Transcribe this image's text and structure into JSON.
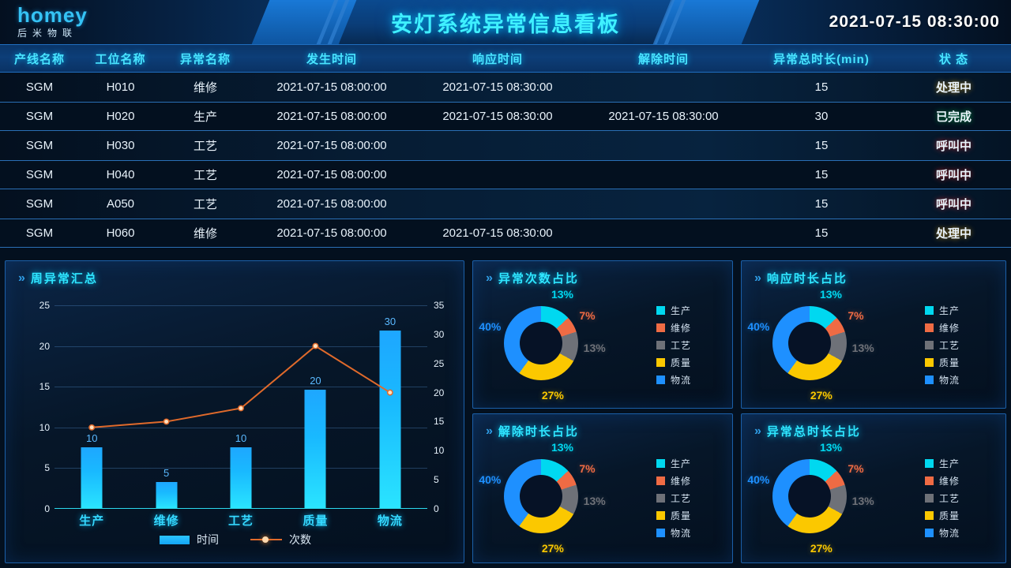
{
  "header": {
    "logo_brand": "homey",
    "logo_sub": "后米物联",
    "title": "安灯系统异常信息看板",
    "datetime": "2021-07-15  08:30:00"
  },
  "table": {
    "columns": [
      "产线名称",
      "工位名称",
      "异常名称",
      "发生时间",
      "响应时间",
      "解除时间",
      "异常总时长(min)",
      "状 态"
    ],
    "rows": [
      {
        "line": "SGM",
        "station": "H010",
        "type": "维修",
        "occur": "2021-07-15 08:00:00",
        "respond": "2021-07-15 08:30:00",
        "release": "",
        "duration": "15",
        "status": "处理中",
        "status_color": "#ffc20e"
      },
      {
        "line": "SGM",
        "station": "H020",
        "type": "生产",
        "occur": "2021-07-15 08:00:00",
        "respond": "2021-07-15 08:30:00",
        "release": "2021-07-15 08:30:00",
        "duration": "30",
        "status": "已完成",
        "status_color": "#21e66a"
      },
      {
        "line": "SGM",
        "station": "H030",
        "type": "工艺",
        "occur": "2021-07-15 08:00:00",
        "respond": "",
        "release": "",
        "duration": "15",
        "status": "呼叫中",
        "status_color": "#ff2020"
      },
      {
        "line": "SGM",
        "station": "H040",
        "type": "工艺",
        "occur": "2021-07-15 08:00:00",
        "respond": "",
        "release": "",
        "duration": "15",
        "status": "呼叫中",
        "status_color": "#ff2020"
      },
      {
        "line": "SGM",
        "station": "A050",
        "type": "工艺",
        "occur": "2021-07-15 08:00:00",
        "respond": "",
        "release": "",
        "duration": "15",
        "status": "呼叫中",
        "status_color": "#ff2020"
      },
      {
        "line": "SGM",
        "station": "H060",
        "type": "维修",
        "occur": "2021-07-15 08:00:00",
        "respond": "2021-07-15 08:30:00",
        "release": "",
        "duration": "15",
        "status": "处理中",
        "status_color": "#ffc20e"
      }
    ]
  },
  "panels": {
    "bar": {
      "title": "周异常汇总"
    },
    "pie_count": {
      "title": "异常次数占比"
    },
    "pie_respond": {
      "title": "响应时长占比"
    },
    "pie_release": {
      "title": "解除时长占比"
    },
    "pie_total": {
      "title": "异常总时长占比"
    }
  },
  "chart_data": [
    {
      "type": "bar",
      "id": "weekly-summary",
      "title": "周异常汇总",
      "categories": [
        "生产",
        "维修",
        "工艺",
        "质量",
        "物流"
      ],
      "series": [
        {
          "name": "时间",
          "type": "bar",
          "axis": "left",
          "values": [
            10,
            5,
            10,
            20,
            30
          ],
          "plot_values": [
            7.5,
            3.2,
            7.5,
            14.5,
            21.8
          ],
          "color": "#20bdff"
        },
        {
          "name": "次数",
          "type": "line",
          "axis": "right",
          "values": [
            14,
            15,
            17.3,
            28,
            20
          ],
          "color": "#e06a2b"
        }
      ],
      "y_left_ticks": [
        0,
        5,
        10,
        15,
        20,
        25
      ],
      "y_right_ticks": [
        0,
        5,
        10,
        15,
        20,
        25,
        30,
        35
      ],
      "ylim_left": [
        0,
        25
      ],
      "ylim_right": [
        0,
        35
      ],
      "grid": true,
      "legend_position": "bottom"
    },
    {
      "type": "pie",
      "id": "count-share",
      "title": "异常次数占比",
      "labels": [
        "生产",
        "维修",
        "工艺",
        "质量",
        "物流"
      ],
      "values": [
        13,
        7,
        13,
        27,
        40
      ],
      "value_labels": [
        "13%",
        "7%",
        "13%",
        "27%",
        "40%"
      ],
      "colors": [
        "#00d8f0",
        "#ef6b44",
        "#6e7178",
        "#fbc800",
        "#1e90ff"
      ],
      "legend_position": "right"
    },
    {
      "type": "pie",
      "id": "respond-share",
      "title": "响应时长占比",
      "labels": [
        "生产",
        "维修",
        "工艺",
        "质量",
        "物流"
      ],
      "values": [
        13,
        7,
        13,
        27,
        40
      ],
      "value_labels": [
        "13%",
        "7%",
        "13%",
        "27%",
        "40%"
      ],
      "colors": [
        "#00d8f0",
        "#ef6b44",
        "#6e7178",
        "#fbc800",
        "#1e90ff"
      ],
      "legend_position": "right"
    },
    {
      "type": "pie",
      "id": "release-share",
      "title": "解除时长占比",
      "labels": [
        "生产",
        "维修",
        "工艺",
        "质量",
        "物流"
      ],
      "values": [
        13,
        7,
        13,
        27,
        40
      ],
      "value_labels": [
        "13%",
        "7%",
        "13%",
        "27%",
        "40%"
      ],
      "colors": [
        "#00d8f0",
        "#ef6b44",
        "#6e7178",
        "#fbc800",
        "#1e90ff"
      ],
      "legend_position": "right"
    },
    {
      "type": "pie",
      "id": "total-share",
      "title": "异常总时长占比",
      "labels": [
        "生产",
        "维修",
        "工艺",
        "质量",
        "物流"
      ],
      "values": [
        13,
        7,
        13,
        27,
        40
      ],
      "value_labels": [
        "13%",
        "7%",
        "13%",
        "27%",
        "40%"
      ],
      "colors": [
        "#00d8f0",
        "#ef6b44",
        "#6e7178",
        "#fbc800",
        "#1e90ff"
      ],
      "legend_position": "right"
    }
  ]
}
